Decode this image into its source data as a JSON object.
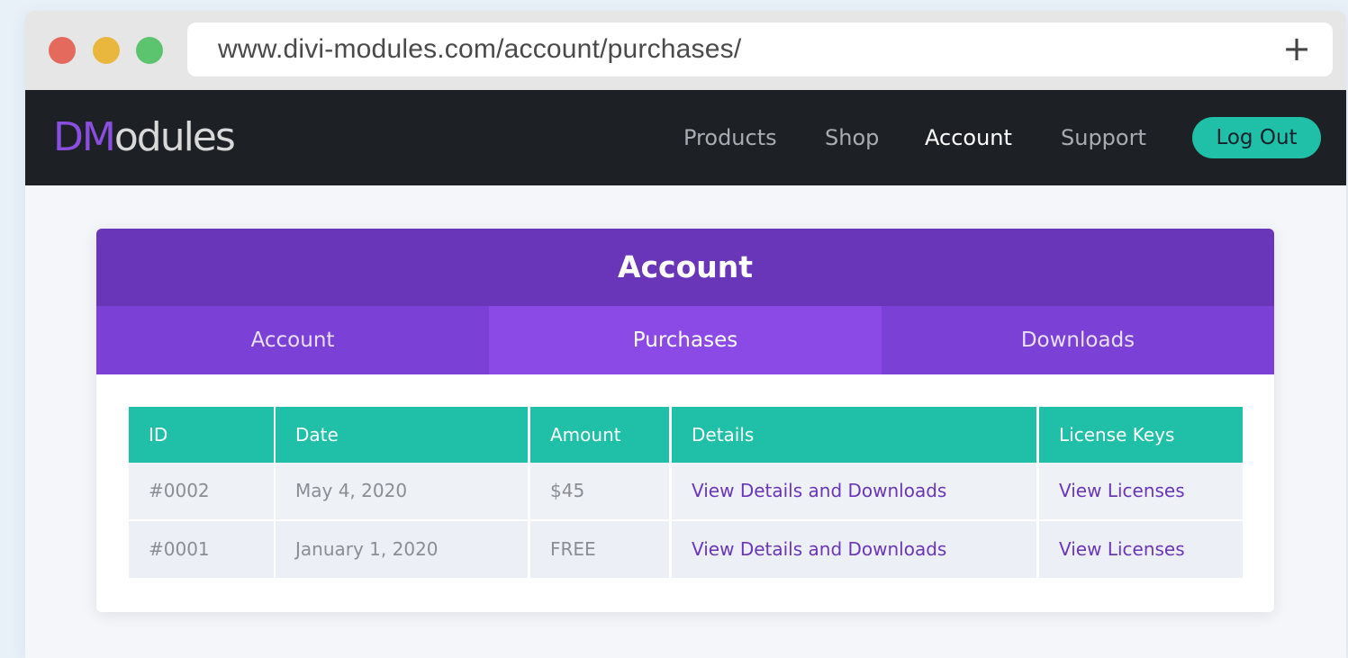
{
  "browser": {
    "url": "www.divi-modules.com/account/purchases/",
    "new_tab_symbol": "+"
  },
  "site": {
    "logo_mark": "DM",
    "logo_rest": "odules",
    "nav": [
      {
        "label": "Products"
      },
      {
        "label": "Shop"
      },
      {
        "label": "Account",
        "active": true
      },
      {
        "label": "Support"
      }
    ],
    "logout_label": "Log Out"
  },
  "account": {
    "title": "Account",
    "tabs": [
      {
        "label": "Account"
      },
      {
        "label": "Purchases",
        "active": true
      },
      {
        "label": "Downloads"
      }
    ]
  },
  "purchases_table": {
    "headers": [
      "ID",
      "Date",
      "Amount",
      "Details",
      "License Keys"
    ],
    "rows": [
      [
        "#0002",
        "May 4, 2020",
        "$45",
        "View Details and Downloads",
        "View Licenses"
      ],
      [
        "#0001",
        "January 1, 2020",
        "FREE",
        "View Details and Downloads",
        "View Licenses"
      ]
    ]
  },
  "colors": {
    "nav_bg": "#1d2125",
    "accent_purple": "#6a36b9",
    "tab_active": "#8b4ae6",
    "teal": "#1fc0a7"
  }
}
